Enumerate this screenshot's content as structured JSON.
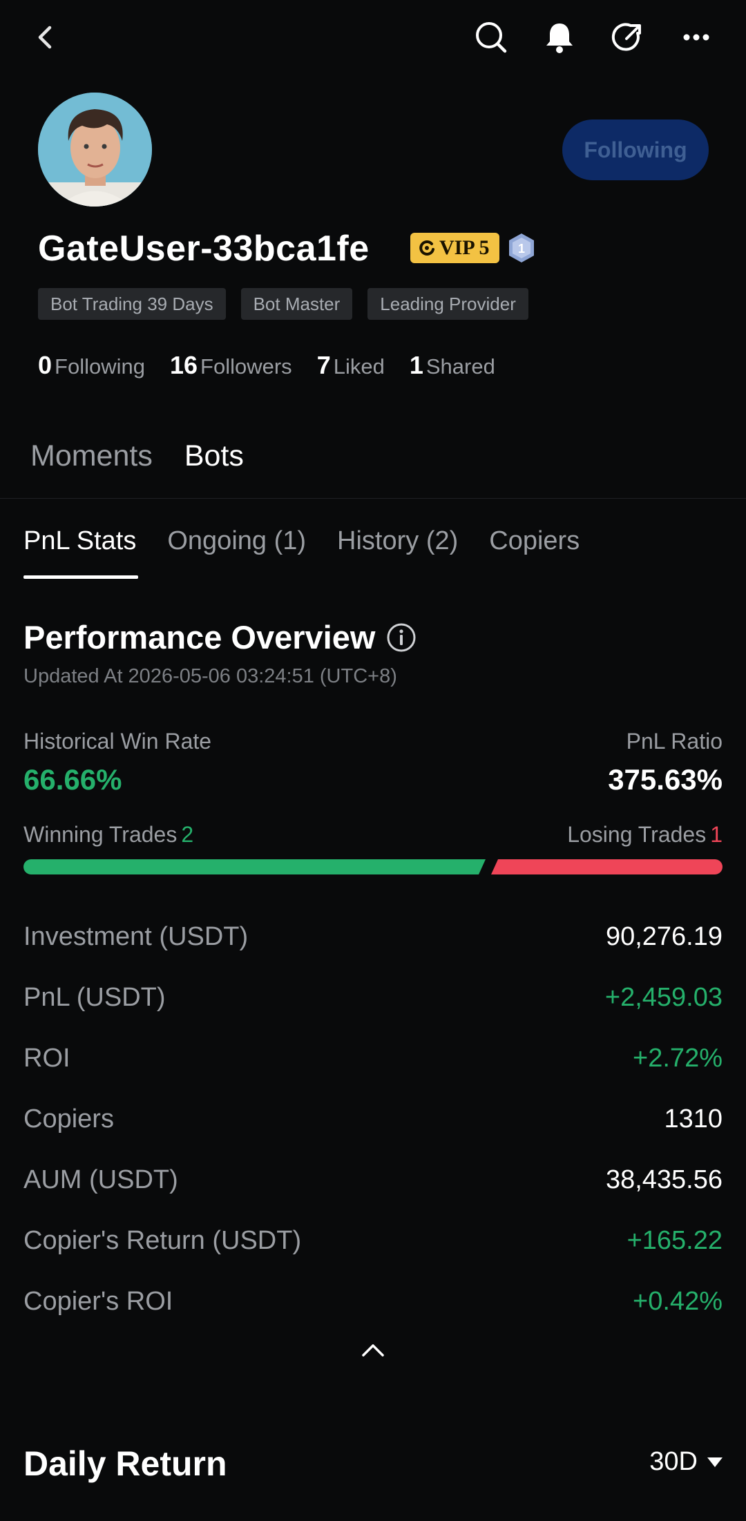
{
  "topbar": {
    "icons": [
      "back-icon",
      "search-icon",
      "bell-icon",
      "share-icon",
      "more-icon"
    ]
  },
  "profile": {
    "username": "GateUser-33bca1fe",
    "vip_label": "VIP 5",
    "level": "1",
    "follow_button": "Following",
    "tags": [
      "Bot Trading 39 Days",
      "Bot Master",
      "Leading Provider"
    ],
    "stats": [
      {
        "value": "0",
        "label": "Following"
      },
      {
        "value": "16",
        "label": "Followers"
      },
      {
        "value": "7",
        "label": "Liked"
      },
      {
        "value": "1",
        "label": "Shared"
      }
    ]
  },
  "main_tabs": [
    "Moments",
    "Bots"
  ],
  "sub_tabs": [
    "PnL Stats",
    "Ongoing (1)",
    "History (2)",
    "Copiers"
  ],
  "performance": {
    "title": "Performance Overview",
    "updated": "Updated At 2026-05-06 03:24:51 (UTC+8)",
    "win_rate_label": "Historical Win Rate",
    "win_rate_value": "66.66%",
    "pnl_ratio_label": "PnL Ratio",
    "pnl_ratio_value": "375.63%",
    "winning_label": "Winning Trades",
    "winning_value": "2",
    "losing_label": "Losing Trades",
    "losing_value": "1",
    "win_fraction": 0.6666,
    "rows": [
      {
        "label": "Investment (USDT)",
        "value": "90,276.19",
        "positive": false
      },
      {
        "label": "PnL (USDT)",
        "value": "+2,459.03",
        "positive": true
      },
      {
        "label": "ROI",
        "value": "+2.72%",
        "positive": true
      },
      {
        "label": "Copiers",
        "value": "1310",
        "positive": false
      },
      {
        "label": "AUM (USDT)",
        "value": "38,435.56",
        "positive": false
      },
      {
        "label": "Copier's Return (USDT)",
        "value": "+165.22",
        "positive": true
      },
      {
        "label": "Copier's ROI",
        "value": "+0.42%",
        "positive": true
      }
    ]
  },
  "daily_return": {
    "title": "Daily Return",
    "period": "30D"
  },
  "colors": {
    "positive": "#25b06b",
    "negative": "#ef4558",
    "vip": "#f3c243",
    "follow_button": "#0d2a66"
  }
}
